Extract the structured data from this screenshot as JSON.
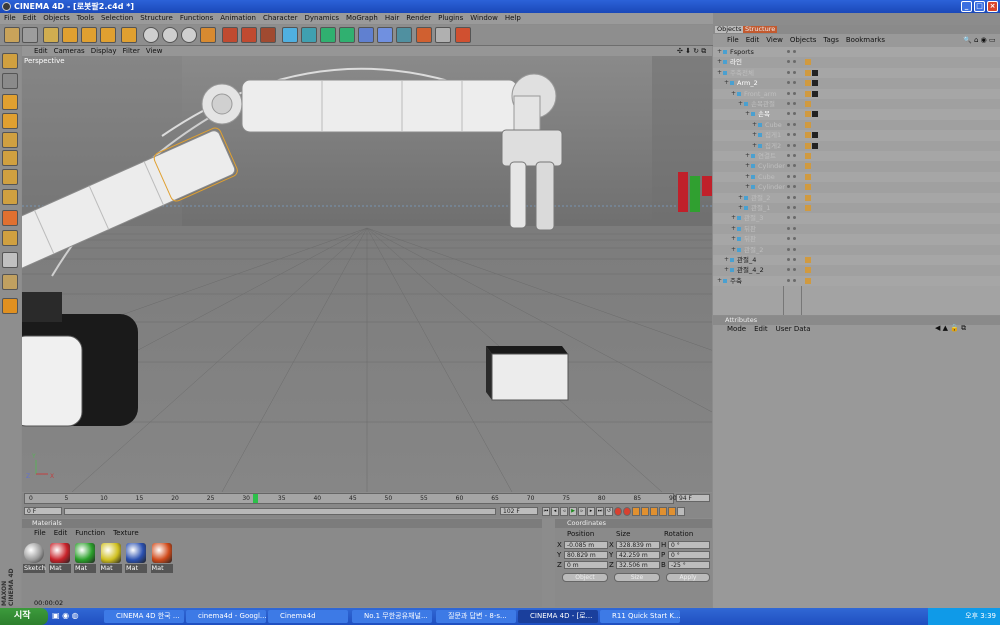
{
  "window": {
    "title": "CINEMA 4D - [로봇팔2.c4d *]"
  },
  "menus": [
    "File",
    "Edit",
    "Objects",
    "Tools",
    "Selection",
    "Structure",
    "Functions",
    "Animation",
    "Character",
    "Dynamics",
    "MoGraph",
    "Hair",
    "Render",
    "Plugins",
    "Window",
    "Help"
  ],
  "viewport": {
    "menus": [
      "Edit",
      "Cameras",
      "Display",
      "Filter",
      "View"
    ],
    "label": "Perspective",
    "nav_icons": "✣ ⬇ ↻ ⧉"
  },
  "timeline": {
    "ticks": [
      "0",
      "5",
      "10",
      "15",
      "20",
      "25",
      "30",
      "35",
      "40",
      "45",
      "50",
      "55",
      "60",
      "65",
      "70",
      "75",
      "80",
      "85",
      "90"
    ],
    "end_frame": "94 F",
    "current_frame": "0 F",
    "range_end": "102 F",
    "playhead_fraction": 0.35,
    "time_display": "00:00:02"
  },
  "materials": {
    "title": "Materials",
    "menus": [
      "File",
      "Edit",
      "Function",
      "Texture"
    ],
    "items": [
      {
        "label": "Sketch",
        "color": "#9a9a9a"
      },
      {
        "label": "Mat",
        "color": "#c8222a"
      },
      {
        "label": "Mat",
        "color": "#2aa02a"
      },
      {
        "label": "Mat",
        "color": "#d0c020"
      },
      {
        "label": "Mat",
        "color": "#2a50b0"
      },
      {
        "label": "Mat",
        "color": "#d04a1a"
      }
    ]
  },
  "coordinates": {
    "title": "Coordinates",
    "headers": [
      "Position",
      "Size",
      "Rotation"
    ],
    "rows": [
      {
        "axis": "X",
        "pos": "-0.085 m",
        "size_axis": "X",
        "size": "328.839 m",
        "rot_axis": "H",
        "rot": "0 °"
      },
      {
        "axis": "Y",
        "pos": "80.829 m",
        "size_axis": "Y",
        "size": "42.259 m",
        "rot_axis": "P",
        "rot": "0 °"
      },
      {
        "axis": "Z",
        "pos": "0 m",
        "size_axis": "Z",
        "size": "32.506 m",
        "rot_axis": "B",
        "rot": "-25 °"
      }
    ],
    "mode": "Object",
    "size_mode": "Size",
    "apply": "Apply"
  },
  "objects": {
    "tabs": [
      "Objects",
      "Structure"
    ],
    "menus": [
      "File",
      "Edit",
      "View",
      "Objects",
      "Tags",
      "Bookmarks"
    ],
    "rows": [
      {
        "name": "Fsports",
        "indent": 0,
        "color": "#1a1a1a",
        "tags": []
      },
      {
        "name": "라인",
        "indent": 0,
        "color": "#ffffff",
        "tags": [
          "#d09a40"
        ]
      },
      {
        "name": "주축전체",
        "indent": 0,
        "color": "#bfbfbf",
        "tags": [
          "#d09a40",
          "#222"
        ]
      },
      {
        "name": "Arm_2",
        "indent": 1,
        "color": "#ffffff",
        "tags": [
          "#d09a40",
          "#222"
        ]
      },
      {
        "name": "Front_arm",
        "indent": 2,
        "color": "#bfbfbf",
        "tags": [
          "#d09a40",
          "#222"
        ]
      },
      {
        "name": "손목관절",
        "indent": 3,
        "color": "#bfbfbf",
        "tags": [
          "#d09a40"
        ]
      },
      {
        "name": "손목",
        "indent": 4,
        "color": "#ffffff",
        "tags": [
          "#d09a40",
          "#222"
        ]
      },
      {
        "name": "Cube",
        "indent": 5,
        "color": "#bfbfbf",
        "tags": [
          "#d09a40"
        ]
      },
      {
        "name": "집게1",
        "indent": 5,
        "color": "#bfbfbf",
        "tags": [
          "#d09a40",
          "#222"
        ]
      },
      {
        "name": "집게2",
        "indent": 5,
        "color": "#bfbfbf",
        "tags": [
          "#d09a40",
          "#222"
        ]
      },
      {
        "name": "연결트",
        "indent": 4,
        "color": "#bfbfbf",
        "tags": [
          "#d09a40"
        ]
      },
      {
        "name": "Cylinder",
        "indent": 4,
        "color": "#bfbfbf",
        "tags": [
          "#d09a40"
        ]
      },
      {
        "name": "Cube",
        "indent": 4,
        "color": "#bfbfbf",
        "tags": [
          "#d09a40"
        ]
      },
      {
        "name": "Cylinder",
        "indent": 4,
        "color": "#bfbfbf",
        "tags": [
          "#d09a40"
        ]
      },
      {
        "name": "관절_2",
        "indent": 3,
        "color": "#bfbfbf",
        "tags": [
          "#d09a40"
        ]
      },
      {
        "name": "관절_1",
        "indent": 3,
        "color": "#bfbfbf",
        "tags": [
          "#d09a40"
        ]
      },
      {
        "name": "관절_3",
        "indent": 2,
        "color": "#bfbfbf",
        "tags": []
      },
      {
        "name": "뒤판",
        "indent": 2,
        "color": "#bfbfbf",
        "tags": []
      },
      {
        "name": "뒤판",
        "indent": 2,
        "color": "#bfbfbf",
        "tags": []
      },
      {
        "name": "관절_2",
        "indent": 2,
        "color": "#bfbfbf",
        "tags": []
      },
      {
        "name": "관절_4",
        "indent": 1,
        "color": "#1a1a1a",
        "tags": [
          "#d09a40"
        ]
      },
      {
        "name": "관절_4_2",
        "indent": 1,
        "color": "#1a1a1a",
        "tags": [
          "#d09a40"
        ]
      },
      {
        "name": "주축",
        "indent": 0,
        "color": "#1a1a1a",
        "tags": [
          "#d09a40"
        ]
      }
    ]
  },
  "attributes": {
    "title": "Attributes",
    "menus": [
      "Mode",
      "Edit",
      "User Data"
    ]
  },
  "taskbar": {
    "start": "시작",
    "tasks": [
      "CINEMA 4D 한국 ...",
      "cinema4d - Googl...",
      "Cinema4d",
      "No.1 무한공유채널...",
      "질문과 답변 - 8-s...",
      "CINEMA 4D - [로...",
      "R11 Quick Start K..."
    ],
    "active_index": 5,
    "clock": "오후 3:39"
  }
}
